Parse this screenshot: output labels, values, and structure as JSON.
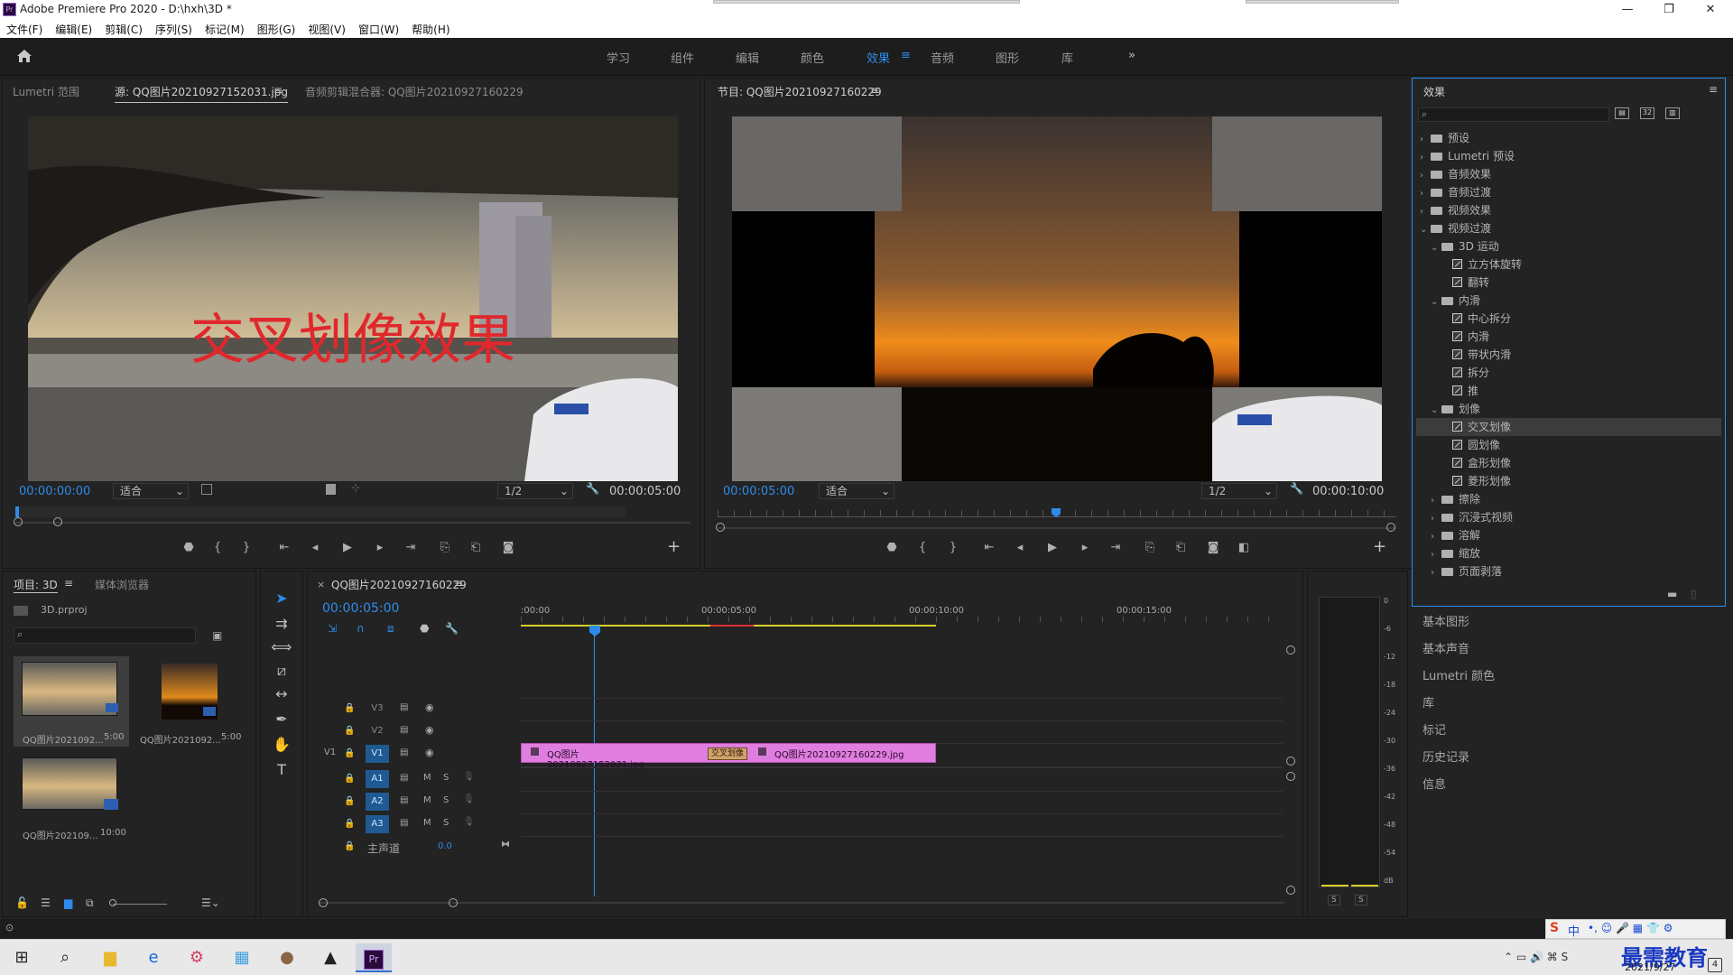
{
  "app": {
    "title": "Adobe Premiere Pro 2020 - D:\\hxh\\3D *",
    "logo": "Pr"
  },
  "window_controls": {
    "minimize": "—",
    "maximize": "❐",
    "close": "✕"
  },
  "menu": [
    "文件(F)",
    "编辑(E)",
    "剪辑(C)",
    "序列(S)",
    "标记(M)",
    "图形(G)",
    "视图(V)",
    "窗口(W)",
    "帮助(H)"
  ],
  "workspaces": {
    "items": [
      "学习",
      "组件",
      "编辑",
      "颜色",
      "效果",
      "音频",
      "图形",
      "库"
    ],
    "active": "效果",
    "more": "»"
  },
  "source_monitor": {
    "tabs": [
      "Lumetri 范围",
      "源: QQ图片20210927152031.jpg",
      "音频剪辑混合器: QQ图片20210927160229"
    ],
    "overlay_text": "交叉划像效果",
    "timecode_in": "00:00:00:00",
    "fit": "适合",
    "resolution": "1/2",
    "timecode_out": "00:00:05:00"
  },
  "program_monitor": {
    "tab": "节目: QQ图片20210927160229",
    "timecode_in": "00:00:05:00",
    "fit": "适合",
    "resolution": "1/2",
    "timecode_out": "00:00:10:00"
  },
  "effects_panel": {
    "title": "效果",
    "tree": [
      {
        "level": 0,
        "kind": "folder",
        "label": "预设",
        "open": false
      },
      {
        "level": 0,
        "kind": "folder",
        "label": "Lumetri 预设",
        "open": false
      },
      {
        "level": 0,
        "kind": "folder",
        "label": "音频效果",
        "open": false
      },
      {
        "level": 0,
        "kind": "folder",
        "label": "音频过渡",
        "open": false
      },
      {
        "level": 0,
        "kind": "folder",
        "label": "视频效果",
        "open": false
      },
      {
        "level": 0,
        "kind": "folder",
        "label": "视频过渡",
        "open": true
      },
      {
        "level": 1,
        "kind": "folder",
        "label": "3D 运动",
        "open": true
      },
      {
        "level": 2,
        "kind": "fx",
        "label": "立方体旋转"
      },
      {
        "level": 2,
        "kind": "fx",
        "label": "翻转"
      },
      {
        "level": 1,
        "kind": "folder",
        "label": "内滑",
        "open": true
      },
      {
        "level": 2,
        "kind": "fx",
        "label": "中心拆分"
      },
      {
        "level": 2,
        "kind": "fx",
        "label": "内滑"
      },
      {
        "level": 2,
        "kind": "fx",
        "label": "带状内滑"
      },
      {
        "level": 2,
        "kind": "fx",
        "label": "拆分"
      },
      {
        "level": 2,
        "kind": "fx",
        "label": "推"
      },
      {
        "level": 1,
        "kind": "folder",
        "label": "划像",
        "open": true
      },
      {
        "level": 2,
        "kind": "fx",
        "label": "交叉划像",
        "selected": true
      },
      {
        "level": 2,
        "kind": "fx",
        "label": "圆划像"
      },
      {
        "level": 2,
        "kind": "fx",
        "label": "盒形划像"
      },
      {
        "level": 2,
        "kind": "fx",
        "label": "菱形划像"
      },
      {
        "level": 1,
        "kind": "folder",
        "label": "擦除",
        "open": false
      },
      {
        "level": 1,
        "kind": "folder",
        "label": "沉浸式视频",
        "open": false
      },
      {
        "level": 1,
        "kind": "folder",
        "label": "溶解",
        "open": false
      },
      {
        "level": 1,
        "kind": "folder",
        "label": "缩放",
        "open": false
      },
      {
        "level": 1,
        "kind": "folder",
        "label": "页面剥落",
        "open": false
      }
    ]
  },
  "side_panels": [
    "基本图形",
    "基本声音",
    "Lumetri 颜色",
    "库",
    "标记",
    "历史记录",
    "信息"
  ],
  "project_panel": {
    "tabs": [
      "项目: 3D",
      "媒体浏览器"
    ],
    "file": "3D.prproj",
    "items": [
      {
        "name": "QQ图片2021092...",
        "dur": "5:00",
        "thumb": "car"
      },
      {
        "name": "QQ图片2021092...",
        "dur": "5:00",
        "thumb": "sunset"
      },
      {
        "name": "QQ图片202109...",
        "dur": "10:00",
        "thumb": "car"
      }
    ]
  },
  "timeline": {
    "tab": "QQ图片20210927160229",
    "timecode": "00:00:05:00",
    "ruler": [
      ":00:00",
      "00:00:05:00",
      "00:00:10:00",
      "00:00:15:00"
    ],
    "tracks": [
      {
        "name": "V3",
        "type": "video"
      },
      {
        "name": "V2",
        "type": "video"
      },
      {
        "name": "V1",
        "type": "video",
        "src": "V1"
      },
      {
        "name": "A1",
        "type": "audio"
      },
      {
        "name": "A2",
        "type": "audio"
      },
      {
        "name": "A3",
        "type": "audio"
      }
    ],
    "master": {
      "label": "主声道",
      "value": "0.0"
    },
    "clips": [
      {
        "track": "V1",
        "label": "QQ图片20210927152031.jpg"
      },
      {
        "track": "V1",
        "label": "交叉划像",
        "transition": true
      },
      {
        "track": "V1",
        "label": "QQ图片20210927160229.jpg"
      }
    ],
    "track_buttons": {
      "mute": "M",
      "solo": "S"
    }
  },
  "audio_meter": {
    "scale": [
      "0",
      "-6",
      "-12",
      "-18",
      "-24",
      "-30",
      "-36",
      "-42",
      "-48",
      "-54",
      "dB"
    ],
    "solo": [
      "S",
      "S"
    ]
  },
  "taskbar": {
    "ime": "中",
    "watermark": "最需教育",
    "date": "2021/9/27",
    "notif": "4"
  },
  "colors": {
    "accent": "#2d8ceb",
    "clip": "#e07ee0",
    "transition": "#d3a26b",
    "workarea": "#d8d02a",
    "playhead": "#2d8ceb",
    "overlay_text": "#e0282c"
  }
}
